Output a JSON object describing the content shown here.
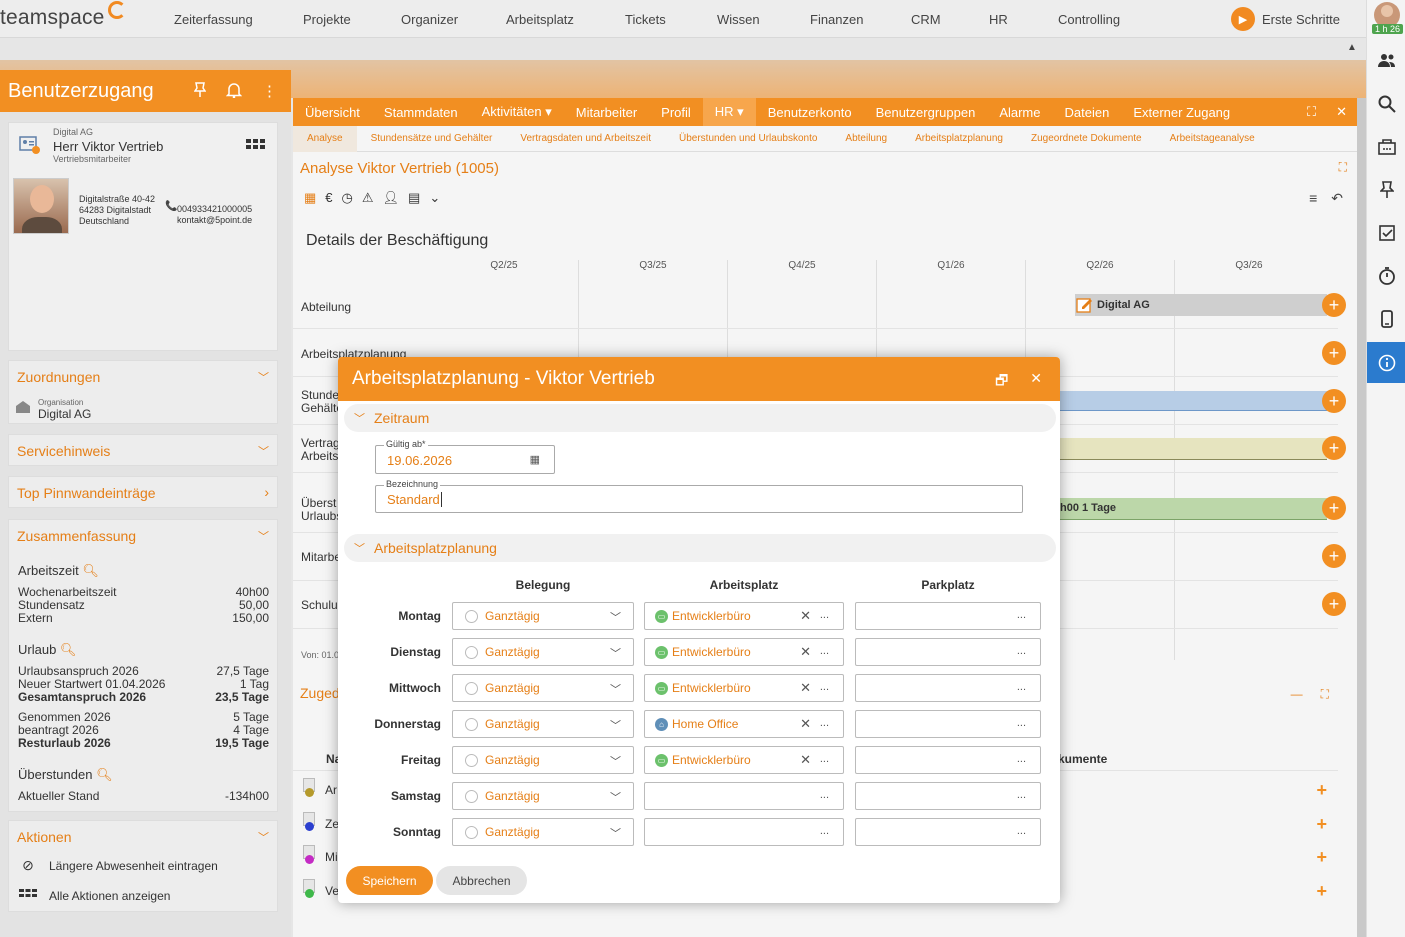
{
  "app": {
    "logo": "teamspace"
  },
  "nav": {
    "items": [
      "Zeiterfassung",
      "Projekte",
      "Organizer",
      "Arbeitsplatz",
      "Tickets",
      "Wissen",
      "Finanzen",
      "CRM",
      "HR",
      "Controlling"
    ],
    "erste_schritte": "Erste Schritte"
  },
  "user_badge": {
    "time": "1 h 26"
  },
  "sidebar_icons": [
    "people-icon",
    "search-icon",
    "folder-icon",
    "pin-icon",
    "task-icon",
    "stopwatch-icon",
    "phone-icon",
    "info-icon"
  ],
  "left_panel": {
    "title": "Benutzerzugang",
    "card": {
      "org": "Digital AG",
      "name": "Herr Viktor Vertrieb",
      "role": "Vertriebsmitarbeiter",
      "address": [
        "Digitalstraße 40-42",
        "64283 Digitalstadt",
        "Deutschland"
      ],
      "phone": "004933421000005",
      "email": "kontakt@5point.de"
    },
    "zuordnungen": {
      "title": "Zuordnungen",
      "org_label": "Organisation",
      "org_value": "Digital AG"
    },
    "servicehinweis": {
      "title": "Servicehinweis"
    },
    "pinnwand": {
      "title": "Top Pinnwandeinträge"
    },
    "summary": {
      "title": "Zusammenfassung",
      "arbeitszeit": {
        "title": "Arbeitszeit",
        "rows": [
          [
            "Wochenarbeitszeit",
            "40h00"
          ],
          [
            "Stundensatz",
            "50,00"
          ],
          [
            "Extern",
            "150,00"
          ]
        ]
      },
      "urlaub": {
        "title": "Urlaub",
        "rows": [
          [
            "Urlaubsanspruch 2026",
            "27,5 Tage"
          ],
          [
            "Neuer Startwert 01.04.2026",
            "1 Tag"
          ],
          [
            "Gesamtanspruch 2026",
            "23,5 Tage"
          ],
          [
            "Genommen 2026",
            "5 Tage"
          ],
          [
            "beantragt 2026",
            "4 Tage"
          ],
          [
            "Resturlaub 2026",
            "19,5 Tage"
          ]
        ]
      },
      "ueberstunden": {
        "title": "Überstunden",
        "rows": [
          [
            "Aktueller Stand",
            "-134h00"
          ]
        ]
      }
    },
    "aktionen": {
      "title": "Aktionen",
      "items": [
        "Längere Abwesenheit eintragen",
        "Alle Aktionen anzeigen"
      ]
    }
  },
  "main": {
    "tabs": [
      "Übersicht",
      "Stammdaten",
      "Aktivitäten ▾",
      "Mitarbeiter",
      "Profil",
      "HR ▾",
      "Benutzerkonto",
      "Benutzergruppen",
      "Alarme",
      "Dateien",
      "Externer Zugang"
    ],
    "sub_tabs": [
      "Analyse",
      "Stundensätze und Gehälter",
      "Vertragsdaten und Arbeitszeit",
      "Überstunden und Urlaubskonto",
      "Abteilung",
      "Arbeitsplatzplanung",
      "Zugeordnete Dokumente",
      "Arbeitstageanalyse"
    ],
    "analyse_title": "Analyse Viktor Vertrieb (1005)",
    "details_title": "Details der Beschäftigung",
    "quarters": [
      "Q2/25",
      "Q3/25",
      "Q4/25",
      "Q1/26",
      "Q2/26",
      "Q3/26"
    ],
    "rows": [
      {
        "label": "Abteilung"
      },
      {
        "label": "Arbeitsplatzplanung"
      },
      {
        "label": "Stunde\nGehälte"
      },
      {
        "label": "Vertrag\nArbeits"
      },
      {
        "label": "Überst\nUrlaubs"
      },
      {
        "label": "Mitarbe"
      },
      {
        "label": "Schulun"
      }
    ],
    "bar_abteilung": "Digital AG",
    "bar_ueberstunden": "h00 1 Tage",
    "von_text": "Von: 01.0",
    "zuge_title": "Zuged",
    "doc_header": {
      "left": "Na",
      "right": "kumente"
    },
    "doc_rows": [
      {
        "text": "Ar",
        "color": "#b59a2b"
      },
      {
        "text": "Ze",
        "color": "#2b3fcf"
      },
      {
        "text": "Mi",
        "color": "#c42bc4"
      },
      {
        "text": "Ve",
        "color": "#3fb84a"
      }
    ]
  },
  "dialog": {
    "title": "Arbeitsplatzplanung - Viktor Vertrieb",
    "zeitraum": "Zeitraum",
    "gueltig_label": "Gültig ab*",
    "gueltig_value": "19.06.2026",
    "bezeichnung_label": "Bezeichnung",
    "bezeichnung_value": "Standard",
    "section2": "Arbeitsplatzplanung",
    "col_belegung": "Belegung",
    "col_arbeitsplatz": "Arbeitsplatz",
    "col_parkplatz": "Parkplatz",
    "days": [
      {
        "day": "Montag",
        "belegung": "Ganztägig",
        "platz": "Entwicklerbüro",
        "type": "office"
      },
      {
        "day": "Dienstag",
        "belegung": "Ganztägig",
        "platz": "Entwicklerbüro",
        "type": "office"
      },
      {
        "day": "Mittwoch",
        "belegung": "Ganztägig",
        "platz": "Entwicklerbüro",
        "type": "office"
      },
      {
        "day": "Donnerstag",
        "belegung": "Ganztägig",
        "platz": "Home Office",
        "type": "home"
      },
      {
        "day": "Freitag",
        "belegung": "Ganztägig",
        "platz": "Entwicklerbüro",
        "type": "office"
      },
      {
        "day": "Samstag",
        "belegung": "Ganztägig",
        "platz": "",
        "type": ""
      },
      {
        "day": "Sonntag",
        "belegung": "Ganztägig",
        "platz": "",
        "type": ""
      }
    ],
    "save": "Speichern",
    "cancel": "Abbrechen"
  },
  "colors": {
    "accent": "#f28f22",
    "accent_text": "#e57f17",
    "office": "#6cc16c",
    "home": "#5f8fb8",
    "info_active": "#2b7bce"
  }
}
